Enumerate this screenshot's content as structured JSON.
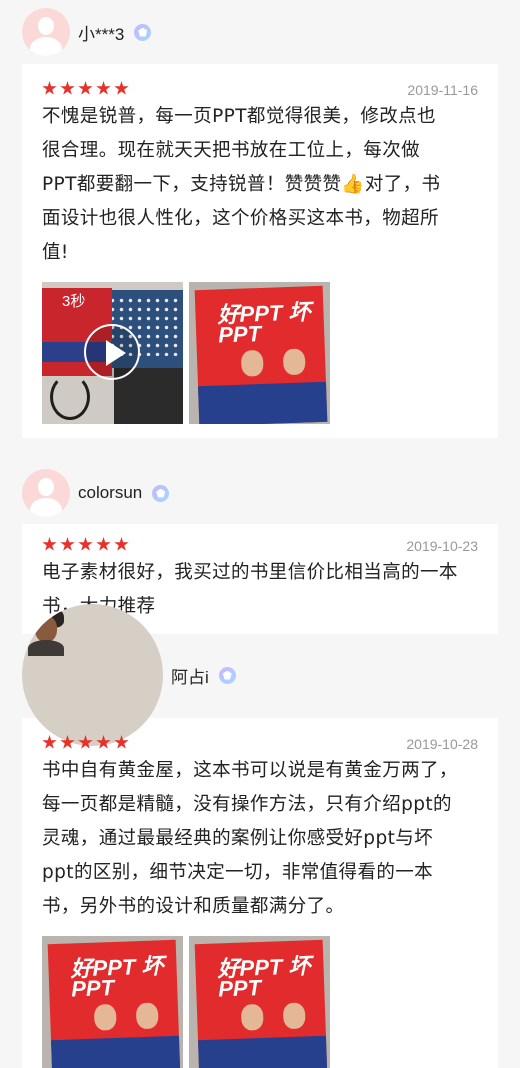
{
  "reviews": [
    {
      "username": "小***3",
      "date": "2019-11-16",
      "rating": 5,
      "lines": [
        "不愧是锐普，每一页PPT都觉得很美，修改点也",
        "很合理。现在就天天把书放在工位上，每次做",
        "PPT都要翻一下，支持锐普！赞赞赞👍对了，书",
        "面设计也很人性化，这个价格买这本书，物超所",
        "值!"
      ],
      "media": [
        {
          "kind": "video",
          "duration": "3秒"
        },
        {
          "kind": "image",
          "cover_title": "好PPT 坏PPT"
        }
      ]
    },
    {
      "username": "colorsun",
      "date": "2019-10-23",
      "rating": 5,
      "lines": [
        "电子素材很好，我买过的书里信价比相当高的一本",
        "书，大力推荐"
      ],
      "media": []
    },
    {
      "username": "阿占i",
      "date": "2019-10-28",
      "rating": 5,
      "lines": [
        "书中自有黄金屋，这本书可以说是有黄金万两了，",
        "每一页都是精髓，没有操作方法，只有介绍ppt的",
        "灵魂，通过最最经典的案例让你感受好ppt与坏",
        "ppt的区别，细节决定一切，非常值得看的一本",
        "书，另外书的设计和质量都满分了。"
      ],
      "media": [
        {
          "kind": "image",
          "cover_title": "好PPT 坏PPT"
        },
        {
          "kind": "image",
          "cover_title": "好PPT 坏PPT"
        }
      ]
    }
  ],
  "colors": {
    "star": "#e8312a",
    "page_bg": "#f6f6f6",
    "card_bg": "#ffffff",
    "date_text": "#999999"
  }
}
